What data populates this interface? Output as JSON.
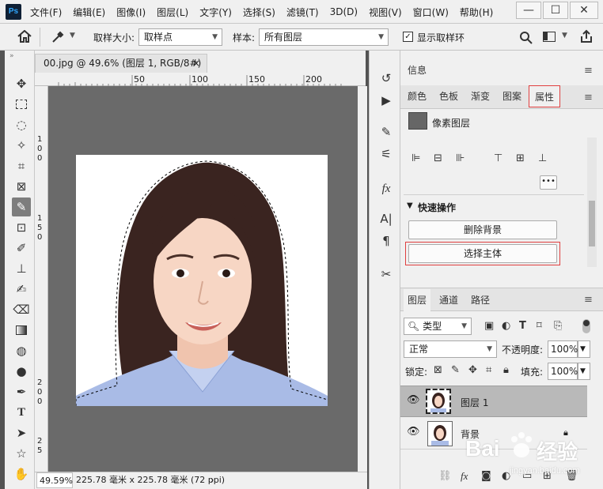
{
  "app": {
    "logo": "Ps"
  },
  "menu": [
    "文件(F)",
    "编辑(E)",
    "图像(I)",
    "图层(L)",
    "文字(Y)",
    "选择(S)",
    "滤镜(T)",
    "3D(D)",
    "视图(V)",
    "窗口(W)",
    "帮助(H)"
  ],
  "window_controls": {
    "minimize": "—",
    "maximize": "☐",
    "close": "✕"
  },
  "options": {
    "sample_size_label": "取样大小:",
    "sample_size_value": "取样点",
    "sample_label": "样本:",
    "sample_value": "所有图层",
    "show_ring_label": "显示取样环",
    "show_ring_checked": true
  },
  "document": {
    "tab_title": "00.jpg @ 49.6% (图层 1, RGB/8#) *",
    "close": "×"
  },
  "ruler": {
    "h_labels": [
      "50",
      "100",
      "150",
      "200"
    ],
    "v_labels": [
      "1",
      "0",
      "0",
      "1",
      "5",
      "0",
      "2",
      "0",
      "0",
      "2",
      "5"
    ]
  },
  "status": {
    "zoom": "49.59%",
    "size": "225.78 毫米 x 225.78 毫米 (72 ppi)",
    "arrow": "›"
  },
  "right_panel": {
    "info_tab": "信息",
    "tabs": [
      "颜色",
      "色板",
      "渐变",
      "图案",
      "属性"
    ],
    "active_tab": "属性",
    "layer_kind": "像素图层",
    "more": "•••",
    "quick_actions_title": "快速操作",
    "quick_actions": [
      "删除背景",
      "选择主体"
    ],
    "highlighted_action": "选择主体"
  },
  "layers_panel": {
    "tabs": [
      "图层",
      "通道",
      "路径"
    ],
    "filter_kind": "类型",
    "blend_mode": "正常",
    "opacity_label": "不透明度:",
    "opacity": "100%",
    "lock_label": "锁定:",
    "fill_label": "填充:",
    "fill": "100%",
    "layers": [
      {
        "name": "图层 1",
        "selected": true,
        "locked": false
      },
      {
        "name": "背景",
        "selected": false,
        "locked": true
      }
    ]
  },
  "watermark": {
    "brand": "Bai",
    "brand_cn": "经验",
    "url": "jingyan.baidu.com"
  },
  "colors": {
    "panel_bg": "#f0f0f0",
    "canvas_bg": "#6a6a6a",
    "highlight": "#e04040",
    "selected_layer": "#b9b9b9"
  }
}
